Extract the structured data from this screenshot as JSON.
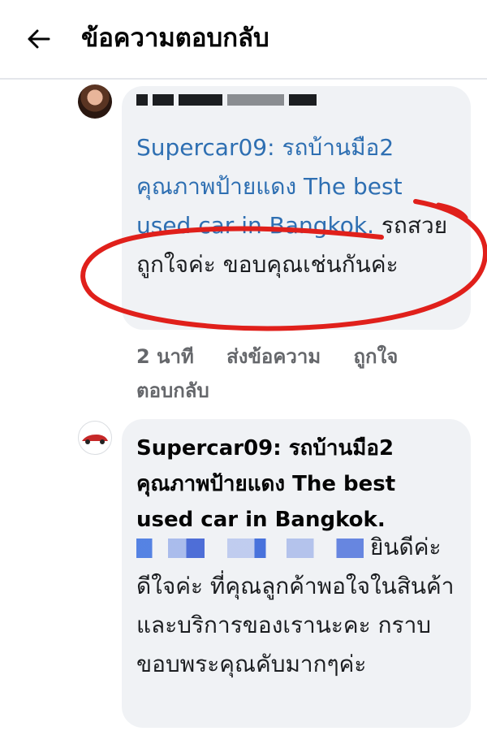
{
  "header": {
    "title": "ข้อความตอบกลับ",
    "back_icon": "arrow-left-icon"
  },
  "comment_1": {
    "quote": "Supercar09: รถบ้านมือ2 คุณภาพป้ายแดง The best used car in Bangkok.",
    "text": " รถสวยถูกใจค่ะ ขอบคุณเช่นกันค่ะ",
    "actions": {
      "time": "2 นาที",
      "send_message": "ส่งข้อความ",
      "like": "ถูกใจ",
      "reply": "ตอบกลับ"
    }
  },
  "comment_2": {
    "quote": "Supercar09: รถบ้านมือ2 คุณภาพป้ายแดง The best used car in Bangkok.",
    "text": "ยินดีค่ะ ดีใจค่ะ ที่คุณลูกค้าพอใจในสินค้าและบริการของเรานะคะ กราบขอบพระคุณคับมากๆค่ะ"
  },
  "colors": {
    "link_blue": "#2e6fb2",
    "bubble_bg": "#f0f2f5",
    "annotation_red": "#e0201b"
  }
}
